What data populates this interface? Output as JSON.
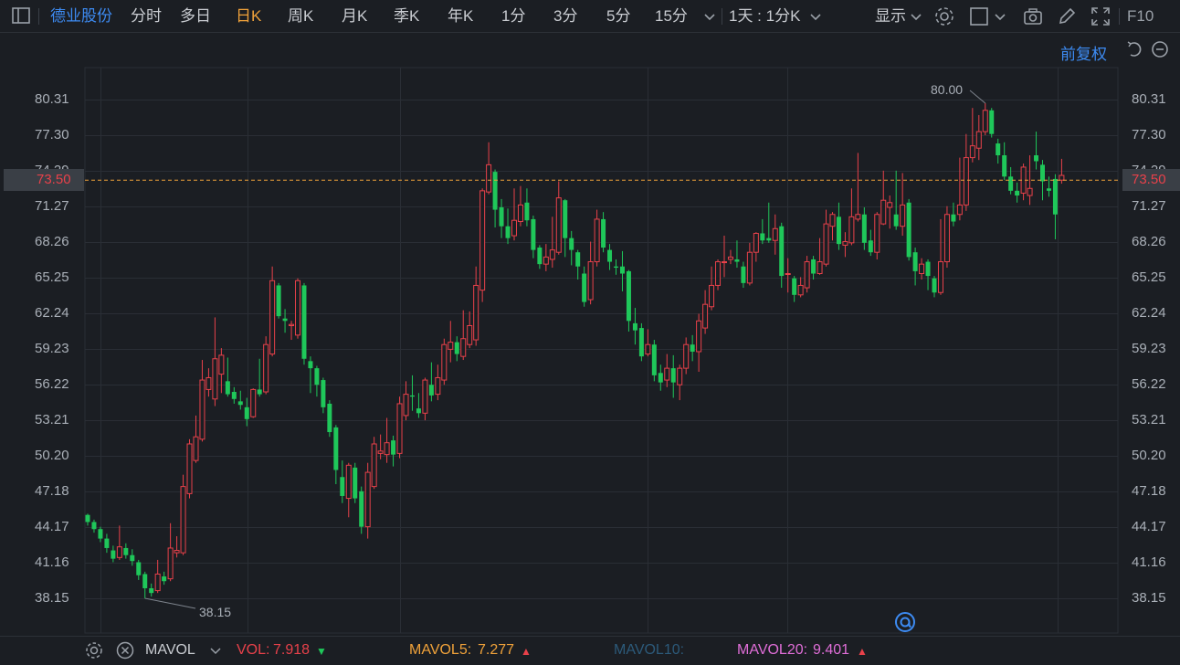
{
  "toolbar": {
    "stock_name": "德业股份",
    "periods": [
      "分时",
      "多日",
      "日K",
      "周K",
      "月K",
      "季K",
      "年K",
      "1分",
      "3分",
      "5分",
      "15分"
    ],
    "active_period": "日K",
    "range_select": "1天 : 1分K",
    "display_label": "显示",
    "f10_label": "F10"
  },
  "subbar": {
    "adjust_label": "前复权"
  },
  "price_axis": {
    "labels": [
      "80.31",
      "77.30",
      "74.29",
      "71.27",
      "68.26",
      "65.25",
      "62.24",
      "59.23",
      "56.22",
      "53.21",
      "50.20",
      "47.18",
      "44.17",
      "41.16",
      "38.15"
    ],
    "current_price": "73.50"
  },
  "annotations": {
    "high_label": "80.00",
    "low_label": "38.15"
  },
  "indicator_bar": {
    "name": "MAVOL",
    "vol_label": "VOL:",
    "vol_value": "7.918",
    "vol_arrow": "▼",
    "mavol5_label": "MAVOL5:",
    "mavol5_value": "7.277",
    "mavol5_arrow": "▲",
    "mavol10_label": "MAVOL10:",
    "mavol20_label": "MAVOL20:",
    "mavol20_value": "9.401",
    "mavol20_arrow": "▲"
  },
  "colors": {
    "up": "#e8414a",
    "down": "#1fc75a",
    "background": "#1b1e23",
    "grid": "#2a2e35",
    "accent": "#f0a23a",
    "link": "#3d8bf2"
  },
  "chart_data": {
    "type": "candlestick",
    "y_range": [
      36.8,
      82.4
    ],
    "highest": 80.0,
    "lowest": 38.15,
    "last_price": 73.5,
    "candles": [
      [
        45.2,
        44.6,
        45.3,
        44.3
      ],
      [
        44.6,
        44.0,
        44.8,
        43.7
      ],
      [
        44.0,
        43.2,
        44.2,
        42.9
      ],
      [
        43.2,
        42.4,
        43.6,
        42.0
      ],
      [
        42.2,
        41.5,
        42.6,
        41.2
      ],
      [
        41.6,
        42.5,
        44.3,
        41.4
      ],
      [
        42.4,
        41.8,
        42.8,
        41.5
      ],
      [
        41.8,
        41.3,
        42.3,
        40.9
      ],
      [
        41.2,
        40.1,
        41.4,
        39.7
      ],
      [
        40.2,
        39.0,
        40.4,
        38.15
      ],
      [
        39.0,
        38.6,
        39.4,
        38.3
      ],
      [
        38.8,
        40.2,
        41.4,
        38.6
      ],
      [
        40.0,
        39.6,
        40.4,
        39.3
      ],
      [
        39.8,
        42.4,
        44.5,
        39.6
      ],
      [
        42.0,
        42.2,
        43.4,
        41.6
      ],
      [
        42.0,
        47.6,
        48.6,
        41.8
      ],
      [
        47.0,
        51.2,
        51.6,
        46.6
      ],
      [
        49.8,
        51.8,
        53.6,
        49.6
      ],
      [
        51.6,
        56.6,
        58.3,
        51.4
      ],
      [
        55.8,
        56.8,
        57.6,
        55.2
      ],
      [
        55.0,
        58.4,
        61.9,
        54.4
      ],
      [
        57.1,
        58.7,
        59.3,
        55.5
      ],
      [
        56.5,
        55.4,
        58.5,
        55.2
      ],
      [
        55.6,
        55.0,
        56.0,
        54.6
      ],
      [
        54.8,
        54.5,
        55.7,
        54.1
      ],
      [
        54.3,
        53.3,
        55.1,
        52.7
      ],
      [
        53.5,
        55.8,
        55.9,
        53.4
      ],
      [
        55.8,
        55.4,
        58.4,
        55.2
      ],
      [
        55.6,
        59.6,
        60.3,
        55.4
      ],
      [
        58.8,
        65.0,
        66.2,
        58.6
      ],
      [
        64.6,
        62.0,
        64.8,
        61.8
      ],
      [
        61.8,
        61.6,
        62.6,
        60.6
      ],
      [
        61.2,
        61.3,
        61.6,
        60.0
      ],
      [
        60.4,
        65.0,
        65.2,
        60.1
      ],
      [
        64.6,
        58.4,
        64.8,
        57.9
      ],
      [
        58.2,
        57.6,
        58.6,
        55.5
      ],
      [
        57.6,
        56.2,
        57.8,
        55.2
      ],
      [
        56.6,
        54.3,
        56.8,
        53.8
      ],
      [
        54.6,
        52.2,
        54.9,
        51.8
      ],
      [
        52.6,
        49.0,
        52.8,
        47.8
      ],
      [
        48.4,
        46.8,
        49.8,
        46.2
      ],
      [
        46.6,
        49.4,
        49.6,
        45.0
      ],
      [
        49.2,
        46.6,
        49.6,
        46.2
      ],
      [
        47.2,
        44.2,
        47.6,
        43.6
      ],
      [
        44.2,
        48.8,
        49.6,
        43.2
      ],
      [
        47.6,
        51.2,
        51.8,
        47.4
      ],
      [
        50.4,
        50.6,
        52.0,
        49.9
      ],
      [
        50.3,
        51.3,
        53.4,
        49.6
      ],
      [
        51.5,
        50.3,
        51.9,
        49.3
      ],
      [
        50.4,
        54.6,
        55.2,
        50.0
      ],
      [
        53.6,
        55.4,
        56.5,
        53.2
      ],
      [
        55.3,
        55.2,
        57.0,
        54.0
      ],
      [
        54.2,
        53.8,
        55.5,
        53.4
      ],
      [
        53.8,
        56.6,
        56.8,
        53.2
      ],
      [
        56.2,
        55.3,
        58.1,
        54.8
      ],
      [
        55.4,
        56.8,
        57.9,
        54.9
      ],
      [
        56.6,
        59.6,
        60.1,
        56.2
      ],
      [
        59.2,
        59.8,
        61.6,
        58.1
      ],
      [
        59.8,
        58.8,
        60.3,
        58.2
      ],
      [
        58.6,
        60.1,
        62.5,
        58.3
      ],
      [
        59.6,
        61.2,
        62.4,
        59.3
      ],
      [
        60.0,
        64.6,
        66.2,
        59.5
      ],
      [
        64.2,
        72.6,
        72.8,
        63.2
      ],
      [
        72.5,
        74.8,
        76.7,
        72.3
      ],
      [
        74.2,
        71.0,
        74.4,
        69.5
      ],
      [
        71.2,
        69.6,
        71.9,
        68.6
      ],
      [
        69.6,
        68.6,
        71.1,
        68.1
      ],
      [
        68.8,
        70.1,
        72.8,
        68.4
      ],
      [
        70.0,
        71.4,
        73.0,
        69.6
      ],
      [
        71.6,
        70.1,
        72.8,
        69.6
      ],
      [
        70.2,
        67.6,
        70.5,
        66.9
      ],
      [
        67.8,
        66.4,
        68.0,
        66.0
      ],
      [
        66.4,
        67.0,
        68.1,
        65.8
      ],
      [
        66.8,
        67.6,
        70.4,
        66.1
      ],
      [
        67.4,
        72.0,
        73.4,
        67.2
      ],
      [
        71.8,
        68.6,
        71.9,
        67.0
      ],
      [
        68.6,
        67.6,
        69.2,
        66.3
      ],
      [
        67.4,
        66.2,
        67.6,
        65.1
      ],
      [
        65.6,
        63.2,
        66.2,
        62.8
      ],
      [
        63.4,
        66.6,
        68.3,
        63.0
      ],
      [
        66.6,
        70.2,
        71.0,
        66.2
      ],
      [
        70.2,
        67.8,
        70.8,
        67.4
      ],
      [
        67.6,
        66.6,
        68.1,
        65.9
      ],
      [
        66.2,
        66.1,
        66.8,
        65.5
      ],
      [
        66.2,
        65.6,
        67.5,
        64.1
      ],
      [
        65.8,
        61.6,
        65.9,
        60.7
      ],
      [
        61.4,
        60.8,
        62.7,
        59.6
      ],
      [
        61.0,
        58.6,
        61.4,
        58.2
      ],
      [
        58.8,
        59.6,
        60.9,
        58.6
      ],
      [
        59.6,
        57.0,
        60.0,
        56.5
      ],
      [
        57.2,
        56.4,
        57.9,
        55.7
      ],
      [
        56.6,
        57.6,
        58.8,
        56.0
      ],
      [
        57.6,
        56.4,
        58.7,
        55.1
      ],
      [
        56.2,
        57.6,
        57.9,
        54.9
      ],
      [
        57.6,
        59.6,
        60.2,
        57.1
      ],
      [
        59.6,
        59.0,
        60.4,
        58.2
      ],
      [
        59.0,
        61.6,
        62.2,
        57.3
      ],
      [
        61.0,
        63.0,
        64.2,
        60.5
      ],
      [
        62.8,
        64.6,
        66.2,
        62.5
      ],
      [
        64.6,
        66.6,
        66.8,
        64.2
      ],
      [
        66.6,
        66.6,
        68.8,
        65.3
      ],
      [
        66.8,
        67.0,
        67.6,
        66.4
      ],
      [
        66.8,
        66.6,
        68.4,
        66.1
      ],
      [
        66.2,
        64.8,
        66.6,
        64.4
      ],
      [
        64.8,
        67.4,
        68.2,
        64.6
      ],
      [
        67.4,
        69.0,
        69.1,
        66.6
      ],
      [
        69.0,
        68.4,
        70.2,
        68.1
      ],
      [
        68.6,
        68.4,
        71.6,
        68.2
      ],
      [
        68.4,
        69.4,
        70.6,
        67.2
      ],
      [
        69.6,
        65.4,
        69.9,
        64.4
      ],
      [
        65.6,
        65.6,
        66.9,
        64.0
      ],
      [
        65.2,
        63.8,
        65.4,
        63.2
      ],
      [
        63.8,
        64.6,
        65.3,
        63.6
      ],
      [
        64.4,
        66.6,
        67.1,
        64.0
      ],
      [
        66.8,
        65.6,
        67.1,
        65.1
      ],
      [
        65.6,
        66.6,
        68.6,
        65.5
      ],
      [
        66.4,
        69.8,
        71.0,
        66.2
      ],
      [
        69.6,
        70.6,
        70.8,
        68.4
      ],
      [
        70.4,
        68.1,
        71.6,
        67.6
      ],
      [
        68.0,
        68.3,
        69.1,
        67.0
      ],
      [
        68.2,
        70.4,
        72.8,
        68.0
      ],
      [
        70.2,
        70.6,
        75.8,
        70.0
      ],
      [
        70.6,
        68.2,
        71.2,
        67.6
      ],
      [
        68.4,
        67.4,
        69.3,
        67.1
      ],
      [
        67.4,
        70.6,
        70.8,
        66.8
      ],
      [
        69.8,
        71.8,
        74.3,
        69.7
      ],
      [
        71.2,
        71.6,
        72.2,
        69.4
      ],
      [
        70.6,
        69.6,
        74.3,
        69.3
      ],
      [
        69.6,
        71.4,
        74.1,
        68.8
      ],
      [
        71.6,
        67.0,
        71.9,
        66.7
      ],
      [
        67.4,
        65.8,
        67.8,
        64.6
      ],
      [
        65.6,
        66.4,
        66.9,
        65.1
      ],
      [
        66.6,
        65.4,
        66.8,
        64.2
      ],
      [
        65.2,
        64.0,
        65.4,
        63.6
      ],
      [
        64.0,
        66.6,
        70.2,
        63.8
      ],
      [
        66.6,
        70.6,
        71.3,
        66.1
      ],
      [
        70.6,
        70.0,
        71.6,
        69.6
      ],
      [
        70.6,
        71.4,
        75.4,
        70.1
      ],
      [
        71.4,
        75.4,
        77.4,
        70.9
      ],
      [
        75.4,
        76.4,
        79.6,
        75.0
      ],
      [
        76.2,
        77.6,
        79.0,
        75.2
      ],
      [
        77.6,
        79.4,
        80.0,
        77.3
      ],
      [
        79.4,
        77.4,
        79.6,
        77.1
      ],
      [
        76.6,
        75.6,
        77.0,
        74.9
      ],
      [
        75.6,
        73.8,
        76.7,
        73.5
      ],
      [
        73.8,
        72.6,
        74.6,
        72.3
      ],
      [
        72.6,
        72.2,
        73.3,
        71.6
      ],
      [
        72.4,
        74.6,
        74.9,
        71.8
      ],
      [
        72.2,
        72.8,
        75.6,
        71.4
      ],
      [
        75.6,
        75.1,
        77.6,
        74.4
      ],
      [
        74.8,
        73.4,
        75.2,
        71.8
      ],
      [
        72.8,
        72.6,
        73.8,
        72.1
      ],
      [
        73.6,
        70.6,
        74.0,
        68.5
      ],
      [
        73.5,
        73.9,
        75.3,
        73.2
      ]
    ]
  }
}
